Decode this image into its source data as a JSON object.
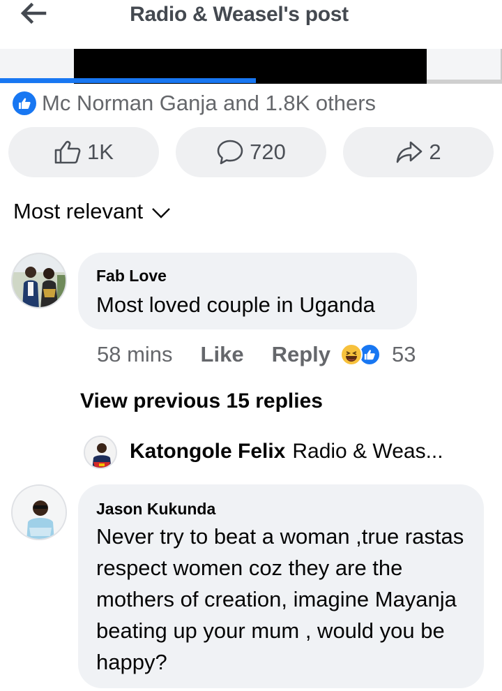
{
  "header": {
    "title": "Radio & Weasel's post",
    "back_icon": "arrow-left-icon"
  },
  "media": {
    "progress_fraction": 0.51
  },
  "reactions": {
    "summary": "Mc Norman Ganja and 1.8K others",
    "badge_icon": "thumbs-up-icon"
  },
  "actions": {
    "like_count": "1K",
    "comment_count": "720",
    "share_count": "2"
  },
  "sort": {
    "label": "Most relevant"
  },
  "comments": [
    {
      "author": "Fab Love",
      "text": "Most loved couple in Uganda",
      "time": "58 mins",
      "like_label": "Like",
      "reply_label": "Reply",
      "reaction_count": "53",
      "reaction_icons": [
        "haha-icon",
        "thumbs-up-icon"
      ]
    },
    {
      "author": "Jason Kukunda",
      "text": "Never try to beat a woman ,true rastas respect women coz they are the mothers of creation, imagine Mayanja beating up your mum , would you be happy?"
    }
  ],
  "replies": {
    "view_previous": "View previous 15 replies",
    "preview_author": "Katongole Felix",
    "preview_text": "Radio & Weas..."
  },
  "colors": {
    "accent": "#1877f2",
    "bubble": "#f0f2f5",
    "secondary_text": "#65676b"
  }
}
